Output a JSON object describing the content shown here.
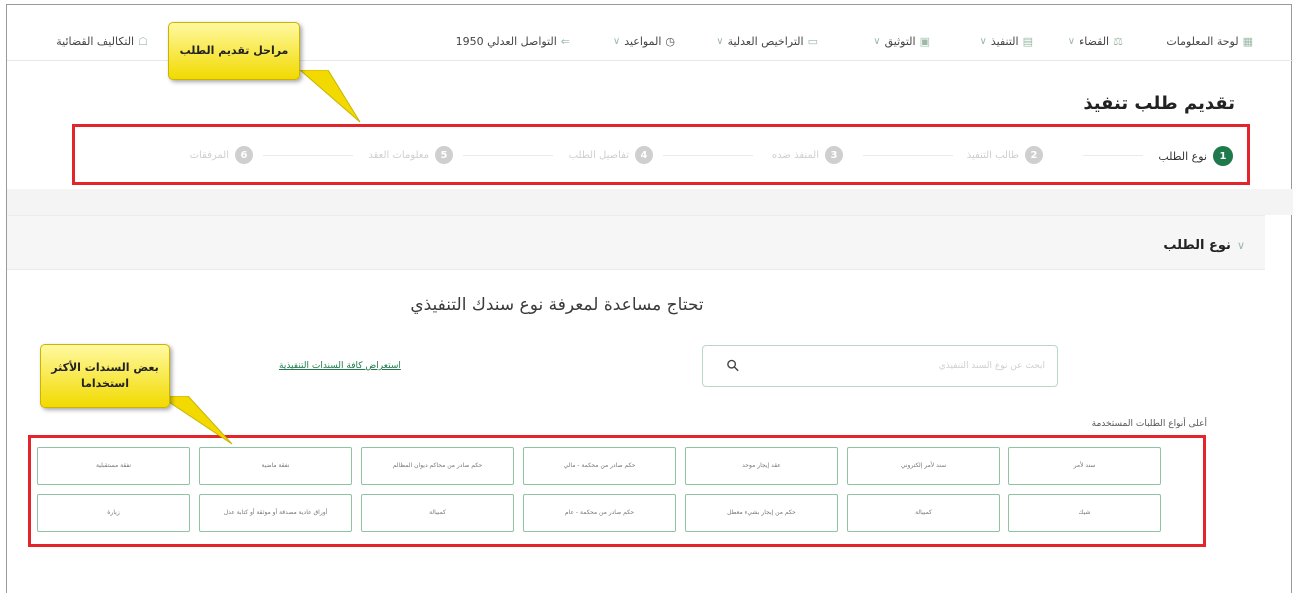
{
  "nav": {
    "items": [
      {
        "label": "لوحة المعلومات",
        "icon": "dashboard-icon",
        "chevron": false
      },
      {
        "label": "القضاء",
        "icon": "gavel-icon",
        "chevron": true
      },
      {
        "label": "التنفيذ",
        "icon": "document-icon",
        "chevron": true
      },
      {
        "label": "التوثيق",
        "icon": "stamp-icon",
        "chevron": true
      },
      {
        "label": "التراخيص العدلية",
        "icon": "license-icon",
        "chevron": true
      },
      {
        "label": "المواعيد",
        "icon": "clock-icon",
        "chevron": true
      },
      {
        "label": "التواصل العدلي 1950",
        "icon": "phone-icon",
        "chevron": false
      },
      {
        "label": "التكاليف القضائية",
        "icon": "coins-icon",
        "chevron": false
      }
    ]
  },
  "page": {
    "title": "تقديم طلب تنفيذ"
  },
  "stepper": {
    "steps": [
      {
        "number": "1",
        "label": "نوع الطلب",
        "active": true
      },
      {
        "number": "2",
        "label": "طالب التنفيذ",
        "active": false
      },
      {
        "number": "3",
        "label": "المنفذ ضده",
        "active": false
      },
      {
        "number": "4",
        "label": "تفاصيل الطلب",
        "active": false
      },
      {
        "number": "5",
        "label": "معلومات العقد",
        "active": false
      },
      {
        "number": "6",
        "label": "المرفقات",
        "active": false
      }
    ]
  },
  "section": {
    "title": "نوع الطلب"
  },
  "help": {
    "title": "تحتاج مساعدة لمعرفة نوع سندك التنفيذي"
  },
  "search": {
    "placeholder": "ابحث عن نوع السند التنفيذي"
  },
  "browse_link": "استعراض كافة السندات التنفيذية",
  "most_used_label": "أعلى أنواع الطلبات المستخدمة",
  "documents": {
    "row1": [
      "سند لأمر",
      "سند لأمر إلكتروني",
      "عقد إيجار موحد",
      "حكم صادر من محكمة - مالي",
      "حكم صادر من محاكم ديوان المظالم",
      "نفقة ماضية",
      "نفقة مستقبلية"
    ],
    "row2": [
      "شيك",
      "كمبيالة",
      "حكم من إيجار بشيء معطل",
      "حكم صادر من محكمة - عام",
      "كمبيالة",
      "أوراق عادية مصدقة أو موثقة أو كتابة عدل",
      "زيارة"
    ]
  },
  "annotations": {
    "stages_callout": "مراحل تقديم الطلب",
    "common_docs_callout": "بعض السندات الأكثر استخداما"
  },
  "colors": {
    "primary_green": "#1e7a4a",
    "card_border": "#8fc4a2",
    "annotation_red": "#e3242b",
    "callout_yellow": "#f2da00"
  }
}
